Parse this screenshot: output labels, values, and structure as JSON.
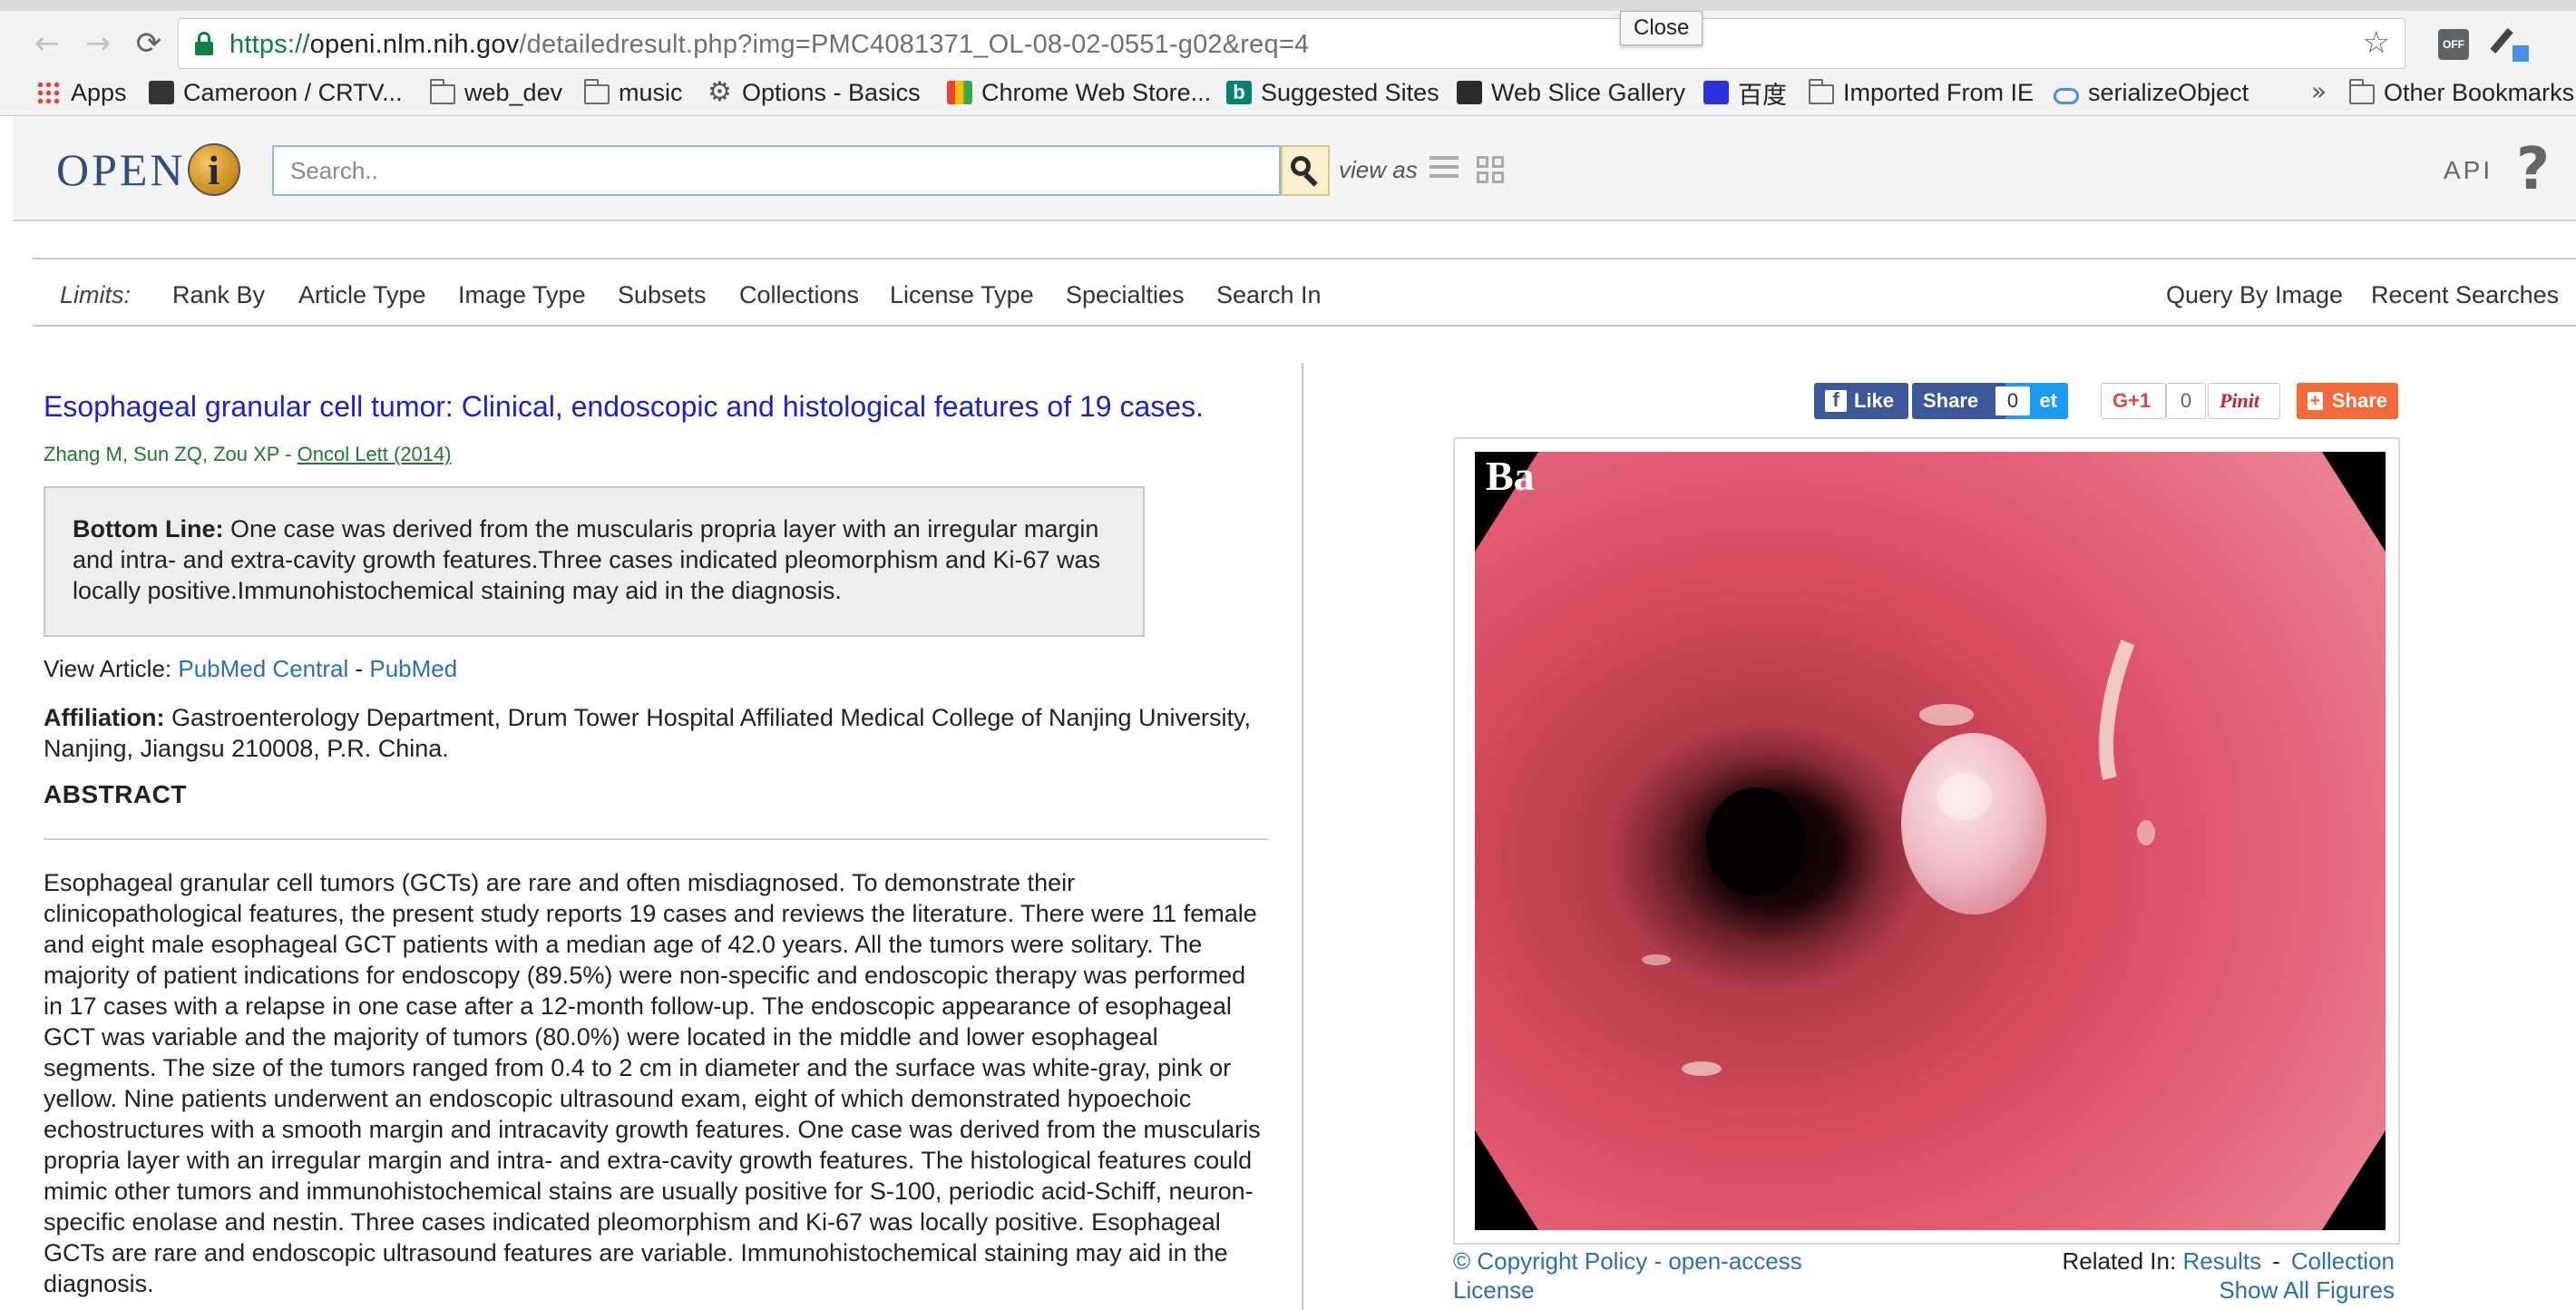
{
  "browser": {
    "url_scheme": "https://",
    "url_host": "openi.nlm.nih.gov",
    "url_path": "/detailedresult.php?img=PMC4081371_OL-08-02-0551-g02&req=4",
    "tooltip": "Close",
    "ext_off_label": "OFF",
    "bookmarks": [
      "Apps",
      "Cameroon / CRTV...",
      "web_dev",
      "music",
      "Options - Basics",
      "Chrome Web Store...",
      "Suggested Sites",
      "Web Slice Gallery",
      "百度",
      "Imported From IE",
      "serializeObject"
    ],
    "bookmarks_overflow": "»",
    "other_bookmarks": "Other Bookmarks"
  },
  "header": {
    "logo_text": "OPEN",
    "logo_i": "i",
    "search_placeholder": "Search..",
    "view_as": "view as",
    "api": "API",
    "help": "?"
  },
  "limits": {
    "label": "Limits:",
    "items": [
      "Rank By",
      "Article Type",
      "Image Type",
      "Subsets",
      "Collections",
      "License Type",
      "Specialties",
      "Search In"
    ],
    "right_items": [
      "Query By Image",
      "Recent Searches"
    ]
  },
  "article": {
    "title": "Esophageal granular cell tumor: Clinical, endoscopic and histological features of 19 cases.",
    "authors": "Zhang M, Sun ZQ, Zou XP",
    "author_sep": " - ",
    "journal": "Oncol Lett (2014)",
    "bottom_line_label": "Bottom Line:",
    "bottom_line_text": " One case was derived from the muscularis propria layer with an irregular margin and intra- and extra-cavity growth features.Three cases indicated pleomorphism and Ki-67 was locally positive.Immunohistochemical staining may aid in the diagnosis.",
    "view_article_label": "View Article: ",
    "pmc_link": "PubMed Central",
    "link_sep": " - ",
    "pubmed_link": "PubMed",
    "affiliation_label": "Affiliation:",
    "affiliation_text": " Gastroenterology Department, Drum Tower Hospital Affiliated Medical College of Nanjing University, Nanjing, Jiangsu 210008, P.R. China.",
    "abstract_heading": "ABSTRACT",
    "abstract": "Esophageal granular cell tumors (GCTs) are rare and often misdiagnosed. To demonstrate their clinicopathological features, the present study reports 19 cases and reviews the literature. There were 11 female and eight male esophageal GCT patients with a median age of 42.0 years. All the tumors were solitary. The majority of patient indications for endoscopy (89.5%) were non-specific and endoscopic therapy was performed in 17 cases with a relapse in one case after a 12-month follow-up. The endoscopic appearance of esophageal GCT was variable and the majority of tumors (80.0%) were located in the middle and lower esophageal segments. The size of the tumors ranged from 0.4 to 2 cm in diameter and the surface was white-gray, pink or yellow. Nine patients underwent an endoscopic ultrasound exam, eight of which demonstrated hypoechoic echostructures with a smooth margin and intracavity growth features. One case was derived from the muscularis propria layer with an irregular margin and intra- and extra-cavity growth features. The histological features could mimic other tumors and immunohistochemical stains are usually positive for S-100, periodic acid-Schiff, neuron-specific enolase and nestin. Three cases indicated pleomorphism and Ki-67 was locally positive. Esophageal GCTs are rare and endoscopic ultrasound features are variable. Immunohistochemical staining may aid in the diagnosis."
  },
  "social": {
    "fb_like": "Like",
    "fb_share": "Share",
    "tweet": "et",
    "tweet_count": "0",
    "gplus": "G+1",
    "gplus_count": "0",
    "pinit": "Pinit",
    "share": "Share"
  },
  "figure": {
    "label": "Ba",
    "copyright_line1": "© Copyright Policy - open-access",
    "copyright_line2": "License",
    "related_label": "Related In: ",
    "results_link": "Results",
    "related_sep": "-",
    "collection_link": "Collection",
    "show_all": "Show All Figures"
  },
  "colors": {
    "title_link": "#1a22d6",
    "author_green": "#1f7a2e",
    "link_blue": "#2a6fbd",
    "facebook": "#3b5998",
    "share_orange": "#f26b3a"
  }
}
